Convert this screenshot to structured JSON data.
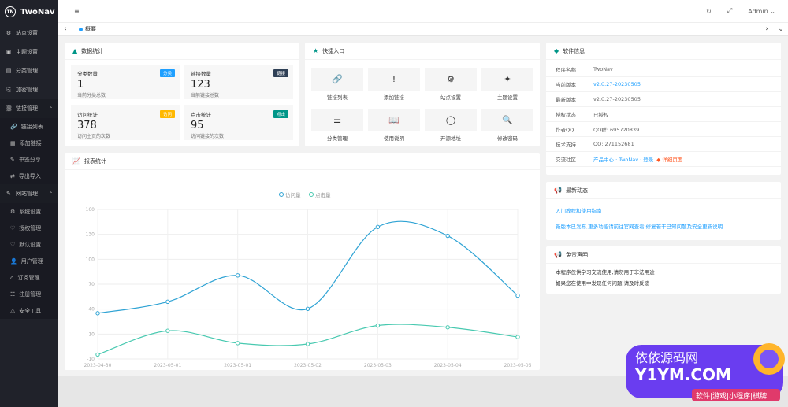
{
  "app": {
    "name": "TwoNav",
    "logo": "TN"
  },
  "sidebar": {
    "items": [
      {
        "icon": "⚙",
        "label": "站点设置",
        "name": "site-settings"
      },
      {
        "icon": "▣",
        "label": "主题设置",
        "name": "theme-settings"
      },
      {
        "icon": "▤",
        "label": "分类管理",
        "name": "category-manage"
      },
      {
        "icon": "⎘",
        "label": "加密管理",
        "name": "encrypt-manage"
      }
    ],
    "group1": {
      "icon": "⛓",
      "label": "链接管理",
      "arrow": "⌃",
      "items": [
        {
          "icon": "🔗",
          "label": "链接列表"
        },
        {
          "icon": "▦",
          "label": "添加链接"
        },
        {
          "icon": "✎",
          "label": "书签分享"
        },
        {
          "icon": "⇄",
          "label": "导出导入"
        }
      ]
    },
    "group2": {
      "icon": "✎",
      "label": "网站管理",
      "arrow": "⌃",
      "items": [
        {
          "icon": "⚙",
          "label": "系统设置"
        },
        {
          "icon": "♡",
          "label": "授权管理"
        },
        {
          "icon": "♡",
          "label": "默认设置"
        },
        {
          "icon": "👤",
          "label": "用户管理"
        },
        {
          "icon": "⌂",
          "label": "订阅管理"
        },
        {
          "icon": "☷",
          "label": "注册管理"
        },
        {
          "icon": "⚠",
          "label": "安全工具"
        }
      ]
    }
  },
  "header": {
    "menu_toggle": "≡",
    "refresh": "↻",
    "fullscreen": "⤢",
    "user": "Admin ⌄"
  },
  "tabs": {
    "prev": "‹",
    "next1": "›",
    "next2": "⌄",
    "active": "概要"
  },
  "data_stats": {
    "title": "数据统计",
    "cards": [
      {
        "label": "分类数量",
        "value": "1",
        "sub": "当前分类总数",
        "badge": "分类",
        "color": "#1e9fff"
      },
      {
        "label": "链接数量",
        "value": "123",
        "sub": "当前链接总数",
        "badge": "链接",
        "color": "#2f4056"
      },
      {
        "label": "访问统计",
        "value": "378",
        "sub": "访问主页的次数",
        "badge": "访问",
        "color": "#ffb800"
      },
      {
        "label": "点击统计",
        "value": "95",
        "sub": "访问链接的次数",
        "badge": "点击",
        "color": "#009688"
      }
    ]
  },
  "quick_entry": {
    "title": "快捷入口",
    "buttons": [
      {
        "icon": "🔗",
        "label": "链接列表"
      },
      {
        "icon": "!",
        "label": "添加链接"
      },
      {
        "icon": "⚙",
        "label": "站点设置"
      },
      {
        "icon": "✦",
        "label": "主题设置"
      },
      {
        "icon": "☰",
        "label": "分类管理"
      },
      {
        "icon": "📖",
        "label": "使用说明"
      },
      {
        "icon": "◯",
        "label": "开源地址"
      },
      {
        "icon": "🔍",
        "label": "修改密码"
      }
    ]
  },
  "report": {
    "title": "报表统计"
  },
  "chart_data": {
    "type": "line",
    "categories": [
      "2023-04-30",
      "2023-05-01",
      "2023-05-01",
      "2023-05-02",
      "2023-05-03",
      "2023-05-04",
      "2023-05-05"
    ],
    "series": [
      {
        "name": "访问量",
        "values": [
          42,
          55,
          85,
          47,
          140,
          130,
          62
        ],
        "color": "#2fa3d4"
      },
      {
        "name": "点击量",
        "values": [
          -5,
          22,
          8,
          7,
          28,
          26,
          15
        ],
        "color": "#48c9b0"
      }
    ],
    "ylim": [
      -10,
      160
    ],
    "yticks": [
      "160",
      "130",
      "100",
      "70",
      "40",
      "10",
      "-10"
    ],
    "legend": "top-center"
  },
  "software_info": {
    "title": "软件信息",
    "rows": [
      {
        "k": "程序名称",
        "v": "TwoNav",
        "link": false
      },
      {
        "k": "当前版本",
        "v": "v2.0.27-20230505",
        "link": true
      },
      {
        "k": "最新版本",
        "v": "v2.0.27-20230505",
        "link": false
      },
      {
        "k": "授权状态",
        "v": "已授权",
        "link": false
      },
      {
        "k": "作者QQ",
        "v": "QQ群: 695720839",
        "link": false
      },
      {
        "k": "技术支持",
        "v": "QQ: 271152681",
        "link": false
      },
      {
        "k": "交流社区",
        "v": "产品中心 · TwoNav · 登录",
        "link": true,
        "extra": "◆ 详细页面"
      }
    ]
  },
  "news": {
    "title": "最新动态",
    "lines": [
      "入门教程和使用指南",
      "新版本已发布,更多功能请前往官网查看,修复若干已知问题及安全更新说明"
    ]
  },
  "notice": {
    "title": "免责声明",
    "lines": [
      "本程序仅供学习交流使用,请勿用于非法用途",
      "如果您在使用中发现任何问题,请及时反馈"
    ]
  },
  "watermark": {
    "line1": "依依源码网",
    "line2": "Y1YM.COM",
    "line3": "软件|游戏|小程序|棋牌"
  }
}
